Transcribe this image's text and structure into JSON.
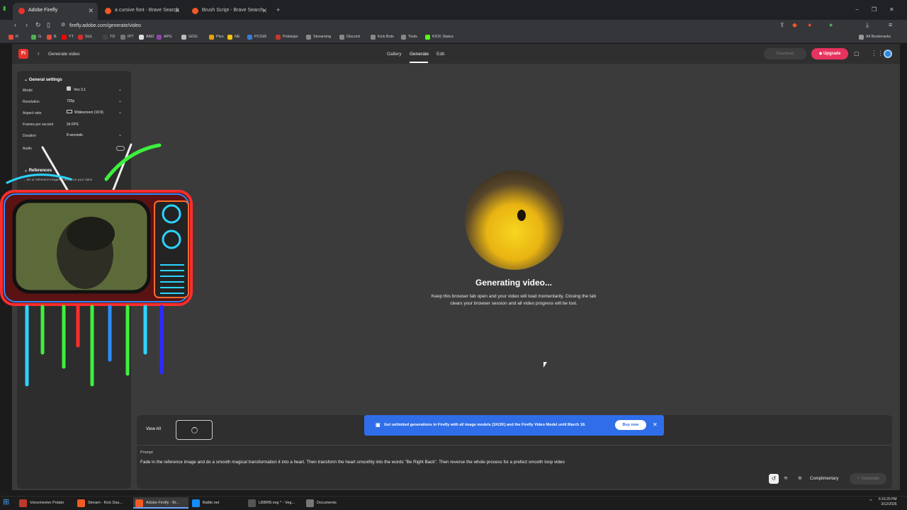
{
  "browser": {
    "tabs": [
      {
        "label": "Adobe Firefly",
        "active": true,
        "color": "#e8322b"
      },
      {
        "label": "a cursive font - Brave Search",
        "active": false,
        "color": "#f05a24"
      },
      {
        "label": "Brush Script - Brave Search",
        "active": false,
        "color": "#f05a24"
      }
    ],
    "new_tab": "+",
    "url": "firefly.adobe.com/generate/video",
    "bookmarks": [
      {
        "label": "R",
        "color": "#e74c3c"
      },
      {
        "label": "G",
        "color": "#4caf50"
      },
      {
        "label": "B",
        "color": "#e84c3d"
      },
      {
        "label": "YT",
        "color": "#ff0000"
      },
      {
        "label": "SUL",
        "color": "#d32f2f"
      },
      {
        "label": "TD",
        "color": "#444"
      },
      {
        "label": "IPT",
        "color": "#777"
      },
      {
        "label": "AMZ",
        "color": "#ddd"
      },
      {
        "label": "APG",
        "color": "#8e44ad"
      },
      {
        "label": "GOG",
        "color": "#bbb"
      },
      {
        "label": "Plex",
        "color": "#e5a00d"
      },
      {
        "label": "NE",
        "color": "#f1c40f"
      },
      {
        "label": "PCGW",
        "color": "#3a7bd5"
      },
      {
        "label": "Polwizjer",
        "color": "#c0392b"
      },
      {
        "label": "Streaming",
        "color": "#888"
      },
      {
        "label": "Discord",
        "color": "#888"
      },
      {
        "label": "Kick Bots",
        "color": "#888"
      },
      {
        "label": "Tools",
        "color": "#888"
      },
      {
        "label": "KICK Status",
        "color": "#53fc18"
      }
    ],
    "all_bookmarks": "All Bookmarks",
    "window_controls": [
      "−",
      "❐",
      "✕"
    ]
  },
  "app": {
    "logo": "Fi",
    "back_title": "Generate video",
    "nav": [
      "Gallery",
      "Generate",
      "Edit"
    ],
    "active_nav": "Generate",
    "download": "Download",
    "upgrade": "Upgrade",
    "accent": "#e8335e"
  },
  "settings": {
    "section": "General settings",
    "rows": [
      {
        "label": "Model",
        "value": "Veo 3.1"
      },
      {
        "label": "Resolution",
        "value": "720p"
      },
      {
        "label": "Aspect ratio",
        "value": "Widescreen (16:9)"
      },
      {
        "label": "Frames per second",
        "value": "24 FPS",
        "static": true
      },
      {
        "label": "Duration",
        "value": "8 seconds"
      }
    ],
    "audio": "Audio",
    "references": "References",
    "references_hint": "...les or reference images to enhance your video"
  },
  "status": {
    "title": "Generating video...",
    "message_line1": "Keep this browser tab open and your video will load momentarily. Closing the tab",
    "message_line2": "clears your browser session and all video progress will be lost."
  },
  "bottom": {
    "view_all": "View All",
    "banner": "Get unlimited generations in Firefly with all image models (1K/2K) and the Firefly Video Model until March 18.",
    "buy_now": "Buy now",
    "prompt_label": "Prompt",
    "prompt": "Fade in the reference image and do a smooth magical transformation it into a heart. Then transform the heart smoothly into the words \"Be Right Back\". Then reverse the whole process for a prefect smooth loop video",
    "complimentary": "Complimentary",
    "generate": "Generate"
  },
  "taskbar": {
    "items": [
      {
        "label": "Voicemeeter Potato",
        "color": "#c0392b"
      },
      {
        "label": "Stream - Kick Das...",
        "color": "#f05a24"
      },
      {
        "label": "Adobe Firefly - Br...",
        "color": "#f05a24"
      },
      {
        "label": "Battle.net",
        "color": "#148eff"
      },
      {
        "label": "LBBRB.veg * - Veg...",
        "color": "#555"
      },
      {
        "label": "Documents",
        "color": "#777"
      }
    ],
    "time": "6:16:20 PM",
    "date": "3/12/2026"
  }
}
